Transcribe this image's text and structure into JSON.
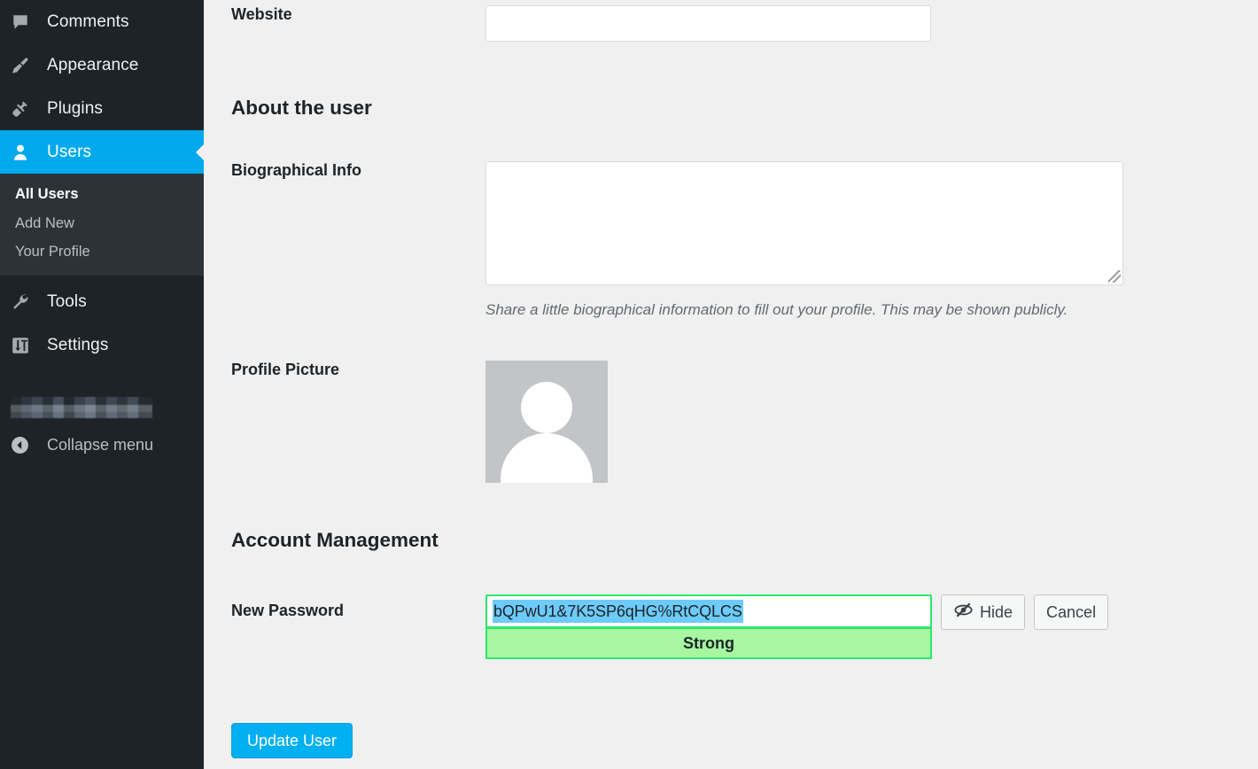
{
  "sidebar": {
    "items": [
      {
        "label": "Comments",
        "icon": "comments-icon",
        "key": "comments",
        "active": false
      },
      {
        "label": "Appearance",
        "icon": "paintbrush-icon",
        "key": "appearance",
        "active": false
      },
      {
        "label": "Plugins",
        "icon": "plug-icon",
        "key": "plugins",
        "active": false
      },
      {
        "label": "Users",
        "icon": "user-icon",
        "key": "users",
        "active": true
      }
    ],
    "submenu": [
      {
        "label": "All Users",
        "current": true
      },
      {
        "label": "Add New",
        "current": false
      },
      {
        "label": "Your Profile",
        "current": false
      }
    ],
    "items_after": [
      {
        "label": "Tools",
        "icon": "wrench-icon",
        "key": "tools",
        "active": false
      },
      {
        "label": "Settings",
        "icon": "sliders-icon",
        "key": "settings",
        "active": false
      }
    ],
    "redacted_item": {
      "label": "",
      "note": "redacted"
    },
    "collapse": {
      "label": "Collapse menu",
      "icon": "collapse-left-icon"
    },
    "colors": {
      "background": "#1d2327",
      "submenu_background": "#2c3338",
      "active": "#00a9ec",
      "text": "#f0f0f1",
      "muted_text": "#b9bfc4"
    }
  },
  "main": {
    "website": {
      "label": "Website",
      "value": "",
      "placeholder": ""
    },
    "about_section": {
      "title": "About the user"
    },
    "biographical_info": {
      "label": "Biographical Info",
      "value": "",
      "placeholder": "",
      "help": "Share a little biographical information to fill out your profile. This may be shown publicly."
    },
    "profile_picture": {
      "label": "Profile Picture",
      "avatar": "default-user-avatar"
    },
    "account_section": {
      "title": "Account Management"
    },
    "new_password": {
      "label": "New Password",
      "value": "bQPwU1&7K5SP6qHG%RtCQLCS",
      "selected": true,
      "strength": "Strong",
      "strength_color": "#a6f7a0",
      "strength_border": "#2ce86a",
      "selection_color": "#6dcbfb",
      "hide_button": "Hide",
      "hide_icon": "eye-slash-icon",
      "cancel_button": "Cancel"
    },
    "submit": {
      "label": "Update User",
      "color": "#00b0f0"
    }
  }
}
